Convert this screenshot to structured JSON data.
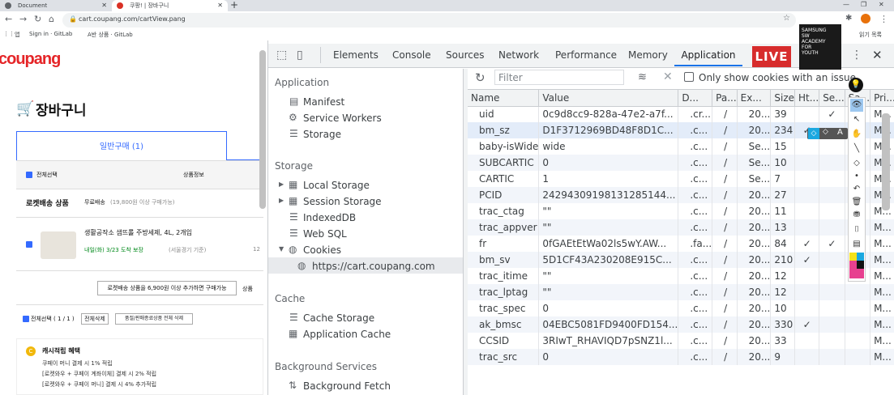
{
  "browser": {
    "tabs": [
      {
        "label": "Document",
        "favicon_color": "#5f6368"
      },
      {
        "label": "쿠팡! | 장바구니",
        "favicon_color": "#d93025"
      }
    ],
    "url": "cart.coupang.com/cartView.pang",
    "bookmarks": [
      "앱",
      "Sign in · GitLab",
      "A반 상품 · GitLab"
    ],
    "bookmarks_right": "읽기 목록"
  },
  "page": {
    "logo": "coupang",
    "cart_title": "장바구니",
    "tab_normal": "일반구매 (1)",
    "select_all": "전체선택",
    "col_product": "상품정보",
    "rocket_section": "로켓배송 상품",
    "free_shipping": "무료배송",
    "free_shipping_note": "(19,800원 이상 구매가능)",
    "product_name": "생활공작소 샘뜨롤 주방세제, 4L, 2개입",
    "delivery": "내일(화) 3/23 도착 보장",
    "delivery_note": "(서울경기 기준)",
    "qty_hint": "12",
    "rocket_note": "로켓배송 상품을 6,900원 이상 추가하면 구매가능",
    "more_btn": "상품",
    "select_count": "전체선택 ( 1 / 1 )",
    "delete_all": "전체삭제",
    "delete_soldout": "품절/판매종료상품 전체 삭제",
    "cash_title": "캐시적립 혜택",
    "cash_lines": [
      "쿠페이 머니 결제 시 1% 적립",
      "[로켓와우 + 쿠페이 계좌이체] 결제 시 2% 적립",
      "[로켓와우 + 쿠페이 머니] 결제 시 4% 추가적립"
    ]
  },
  "devtools": {
    "tabs": [
      "Elements",
      "Console",
      "Sources",
      "Network",
      "Performance",
      "Memory",
      "Application"
    ],
    "active_tab": "Application",
    "sidebar": {
      "application_header": "Application",
      "application_items": [
        "Manifest",
        "Service Workers",
        "Storage"
      ],
      "storage_header": "Storage",
      "storage_items": [
        "Local Storage",
        "Session Storage",
        "IndexedDB",
        "Web SQL",
        "Cookies"
      ],
      "cookie_origin": "https://cart.coupang.com",
      "cache_header": "Cache",
      "cache_items": [
        "Cache Storage",
        "Application Cache"
      ],
      "bg_header": "Background Services",
      "bg_items": [
        "Background Fetch"
      ]
    },
    "filter_placeholder": "Filter",
    "only_issue_label": "Only show cookies with an issue",
    "columns": [
      "Name",
      "Value",
      "D...",
      "Pa...",
      "Ex...",
      "Size",
      "Ht...",
      "Se...",
      "Sa...",
      "Pri..."
    ],
    "rows": [
      [
        "uid",
        "0c9d8cc9-828a-47e2-a7f...",
        ".cr...",
        "/",
        "20...",
        "39",
        "",
        "✓",
        "N...",
        "M..."
      ],
      [
        "bm_sz",
        "D1F3712969BD48F8D1C...",
        ".c...",
        "/",
        "20...",
        "234",
        "✓",
        "",
        "",
        "M..."
      ],
      [
        "baby-isWide",
        "wide",
        ".c...",
        "/",
        "Se...",
        "15",
        "",
        "",
        "",
        "M..."
      ],
      [
        "SUBCARTIC",
        "0",
        ".c...",
        "/",
        "Se...",
        "10",
        "",
        "",
        "",
        "M..."
      ],
      [
        "CARTIC",
        "1",
        ".c...",
        "/",
        "Se...",
        "7",
        "",
        "",
        "",
        "M..."
      ],
      [
        "PCID",
        "24294309198131285144...",
        ".c...",
        "/",
        "20...",
        "27",
        "",
        "",
        "",
        "M..."
      ],
      [
        "trac_ctag",
        "\"\"",
        ".c...",
        "/",
        "20...",
        "11",
        "",
        "",
        "",
        "M..."
      ],
      [
        "trac_appver",
        "\"\"",
        ".c...",
        "/",
        "20...",
        "13",
        "",
        "",
        "",
        "M..."
      ],
      [
        "fr",
        "0fGAEtEtWa02ls5wY.AW...",
        ".fa...",
        "/",
        "20...",
        "84",
        "✓",
        "✓",
        "N...",
        "M..."
      ],
      [
        "bm_sv",
        "5D1CF43A230208E915C...",
        ".c...",
        "/",
        "20...",
        "210",
        "✓",
        "",
        "",
        "M..."
      ],
      [
        "trac_itime",
        "\"\"",
        ".c...",
        "/",
        "20...",
        "12",
        "",
        "",
        "",
        "M..."
      ],
      [
        "trac_lptag",
        "\"\"",
        ".c...",
        "/",
        "20...",
        "12",
        "",
        "",
        "",
        "M..."
      ],
      [
        "trac_spec",
        "0",
        ".c...",
        "/",
        "20...",
        "10",
        "",
        "",
        "",
        "M..."
      ],
      [
        "ak_bmsc",
        "04EBC5081FD9400FD154...",
        ".c...",
        "/",
        "20...",
        "330",
        "✓",
        "",
        "",
        "M..."
      ],
      [
        "CCSID",
        "3RIwT_RHAVIQD7pSNZ1l...",
        ".c...",
        "/",
        "20...",
        "33",
        "",
        "",
        "",
        "M..."
      ],
      [
        "trac_src",
        "0",
        ".c...",
        "/",
        "20...",
        "9",
        "",
        "",
        "",
        "M..."
      ]
    ]
  },
  "overlay": {
    "live": "LIVE",
    "academy_lines": [
      "SAMSUNG",
      "SW",
      "ACADEMY",
      "FOR",
      "YOUTH"
    ]
  },
  "colors": {
    "accent": "#1a73e8",
    "coupang_red": "#e52528",
    "live_red": "#d72c2c"
  }
}
